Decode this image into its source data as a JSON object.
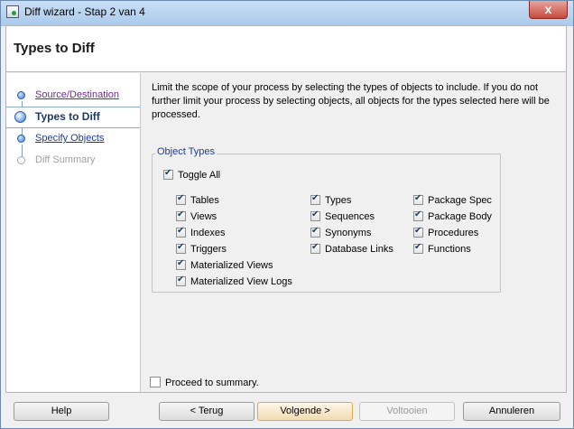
{
  "window": {
    "title": "Diff wizard - Stap 2 van 4",
    "close_label": "x"
  },
  "header": {
    "title": "Types to Diff"
  },
  "steps": [
    {
      "label": "Source/Destination",
      "state": "done"
    },
    {
      "label": "Types to Diff",
      "state": "current"
    },
    {
      "label": "Specify Objects",
      "state": "link"
    },
    {
      "label": "Diff Summary",
      "state": "disabled"
    }
  ],
  "description": "Limit the scope of your process by selecting the types of objects to include.  If you do not further limit your process by selecting objects, all objects for the types selected here will be processed.",
  "object_types": {
    "legend": "Object Types",
    "toggle_all": {
      "label": "Toggle All",
      "checked": true
    },
    "col1": [
      {
        "label": "Tables",
        "checked": true
      },
      {
        "label": "Views",
        "checked": true
      },
      {
        "label": "Indexes",
        "checked": true
      },
      {
        "label": "Triggers",
        "checked": true
      },
      {
        "label": "Materialized Views",
        "checked": true
      },
      {
        "label": "Materialized View Logs",
        "checked": true
      }
    ],
    "col2": [
      {
        "label": "Types",
        "checked": true
      },
      {
        "label": "Sequences",
        "checked": true
      },
      {
        "label": "Synonyms",
        "checked": true
      },
      {
        "label": "Database Links",
        "checked": true
      }
    ],
    "col3": [
      {
        "label": "Package Spec",
        "checked": true
      },
      {
        "label": "Package Body",
        "checked": true
      },
      {
        "label": "Procedures",
        "checked": true
      },
      {
        "label": "Functions",
        "checked": true
      }
    ]
  },
  "proceed": {
    "label": "Proceed to summary.",
    "checked": false
  },
  "buttons": {
    "help": "Help",
    "back": "< Terug",
    "next": "Volgende >",
    "finish": "Voltooien",
    "cancel": "Annuleren"
  }
}
